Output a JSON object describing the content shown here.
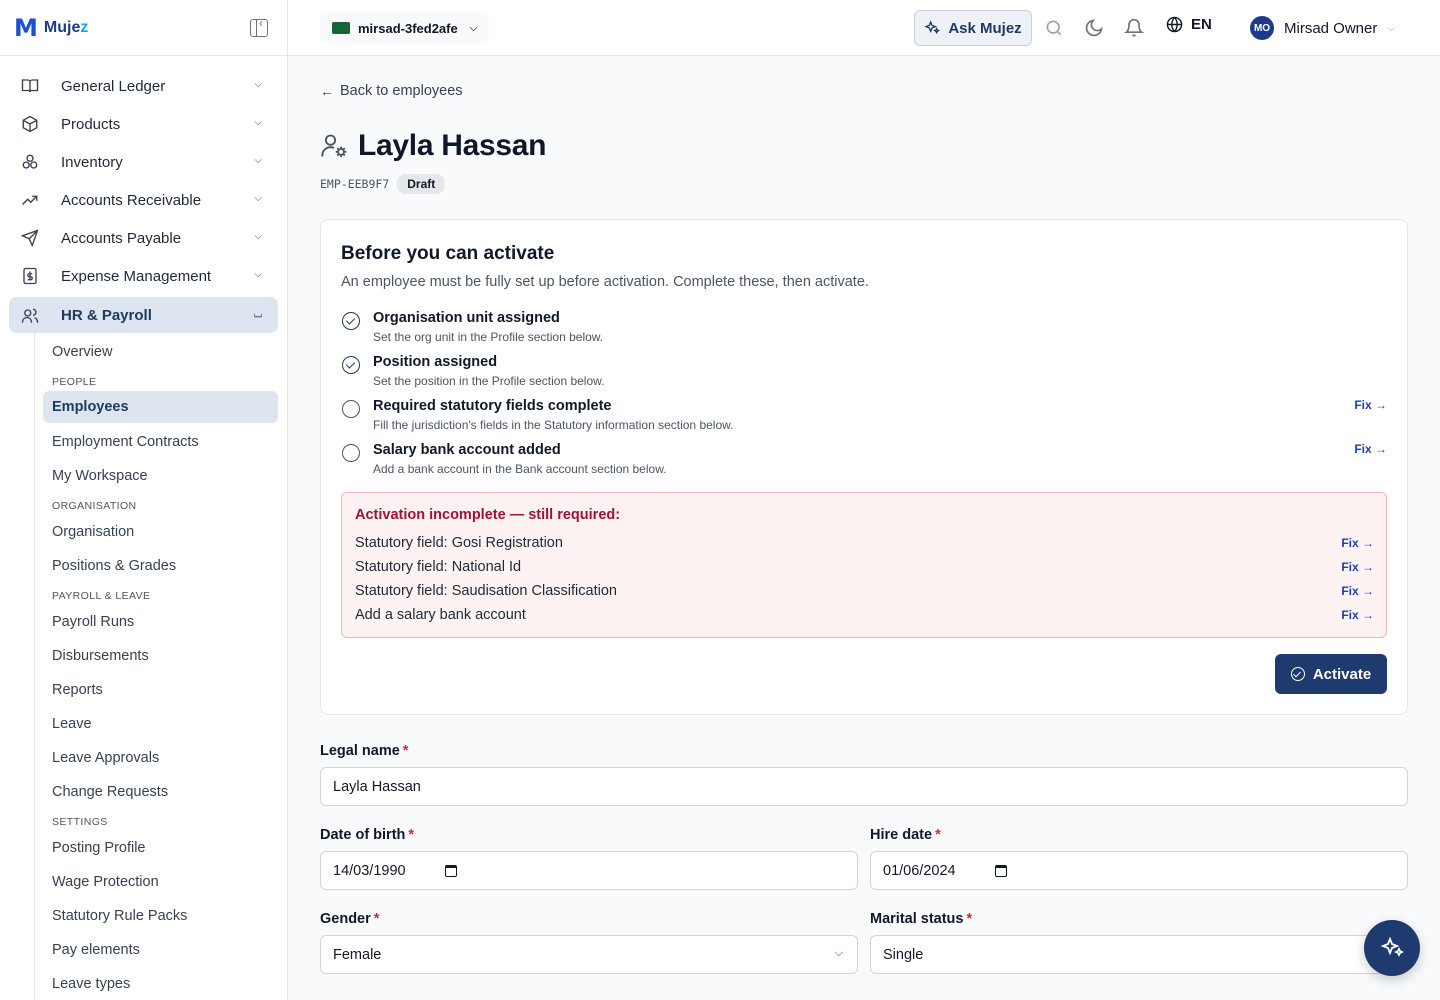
{
  "app": {
    "logo_mark": "M",
    "logo_text_a": "Muje",
    "logo_text_b": "z"
  },
  "nav": {
    "items": [
      {
        "label": "General Ledger"
      },
      {
        "label": "Products"
      },
      {
        "label": "Inventory"
      },
      {
        "label": "Accounts Receivable"
      },
      {
        "label": "Accounts Payable"
      },
      {
        "label": "Expense Management"
      },
      {
        "label": "HR & Payroll"
      }
    ],
    "hr": {
      "overview": "Overview",
      "sec_people": "PEOPLE",
      "employees": "Employees",
      "employment_contracts": "Employment Contracts",
      "my_workspace": "My Workspace",
      "sec_org": "ORGANISATION",
      "organisation": "Organisation",
      "positions_grades": "Positions & Grades",
      "sec_payroll": "PAYROLL & LEAVE",
      "payroll_runs": "Payroll Runs",
      "disbursements": "Disbursements",
      "reports": "Reports",
      "leave": "Leave",
      "leave_approvals": "Leave Approvals",
      "change_requests": "Change Requests",
      "sec_settings": "SETTINGS",
      "posting_profile": "Posting Profile",
      "wage_protection": "Wage Protection",
      "statutory_rule_packs": "Statutory Rule Packs",
      "pay_elements": "Pay elements",
      "leave_types": "Leave types"
    }
  },
  "topbar": {
    "company": "mirsad-3fed2afe",
    "ask": "Ask Mujez",
    "lang": "EN",
    "user_initials": "MO",
    "user_name": "Mirsad Owner"
  },
  "page": {
    "back": "Back to employees",
    "name": "Layla Hassan",
    "code": "EMP-EEB9F7",
    "status": "Draft"
  },
  "activation": {
    "title": "Before you can activate",
    "description": "An employee must be fully set up before activation. Complete these, then activate.",
    "checks": [
      {
        "label": "Organisation unit assigned",
        "hint": "Set the org unit in the Profile section below.",
        "done": true
      },
      {
        "label": "Position assigned",
        "hint": "Set the position in the Profile section below.",
        "done": true
      },
      {
        "label": "Required statutory fields complete",
        "hint": "Fill the jurisdiction's fields in the Statutory information section below.",
        "done": false,
        "fix": "Fix →"
      },
      {
        "label": "Salary bank account added",
        "hint": "Add a bank account in the Bank account section below.",
        "done": false,
        "fix": "Fix →"
      }
    ],
    "alert_title": "Activation incomplete — still required:",
    "alert_rows": [
      {
        "text": "Statutory field: Gosi Registration",
        "fix": "Fix →"
      },
      {
        "text": "Statutory field: National Id",
        "fix": "Fix →"
      },
      {
        "text": "Statutory field: Saudisation Classification",
        "fix": "Fix →"
      },
      {
        "text": "Add a salary bank account",
        "fix": "Fix →"
      }
    ],
    "button": "Activate"
  },
  "form": {
    "legal_name": {
      "label": "Legal name",
      "value": "Layla Hassan"
    },
    "dob": {
      "label": "Date of birth",
      "value": "14/03/1990"
    },
    "hire_date": {
      "label": "Hire date",
      "value": "01/06/2024"
    },
    "gender": {
      "label": "Gender",
      "value": "Female"
    },
    "marital": {
      "label": "Marital status",
      "value": "Single"
    }
  }
}
